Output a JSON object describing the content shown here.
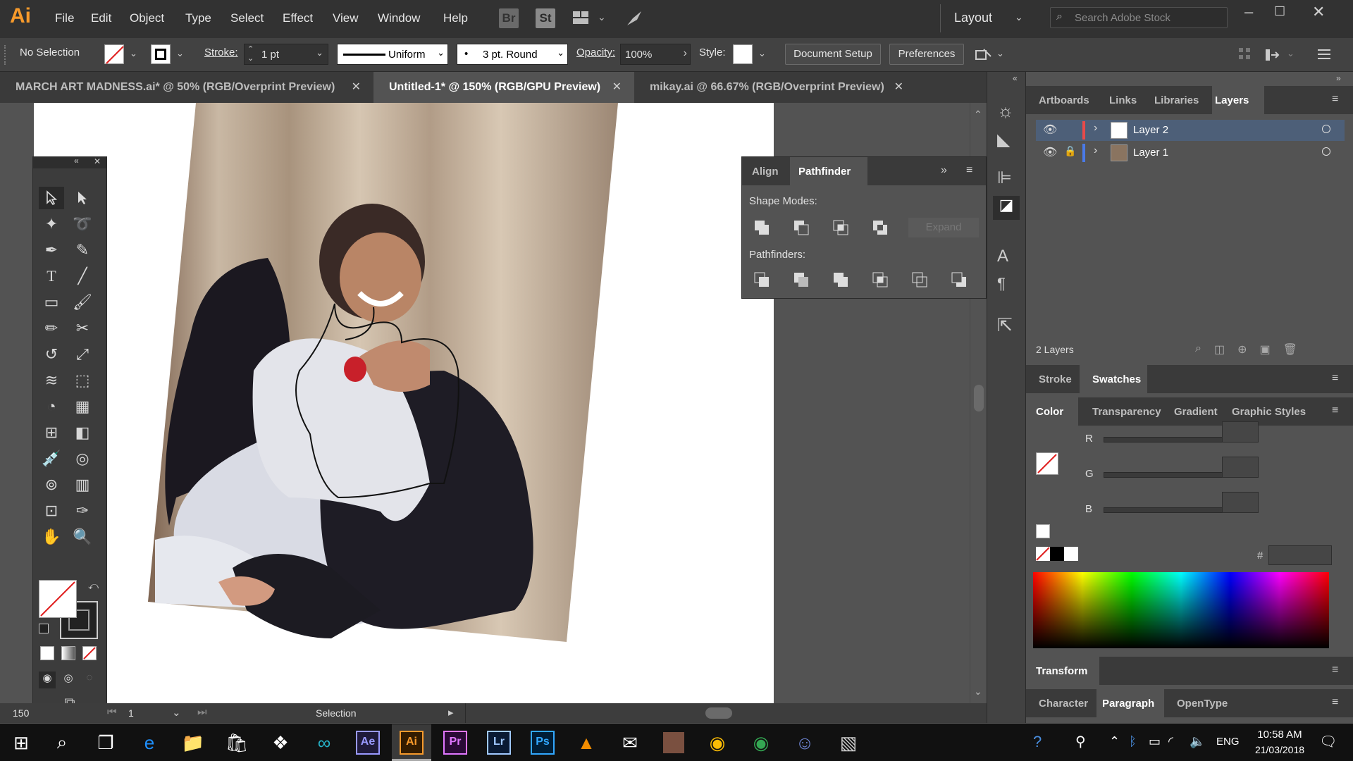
{
  "app": {
    "logo": "Ai"
  },
  "menu": [
    "File",
    "Edit",
    "Object",
    "Type",
    "Select",
    "Effect",
    "View",
    "Window",
    "Help"
  ],
  "bridge_btns": [
    "Br",
    "St"
  ],
  "workspace": {
    "label": "Layout"
  },
  "stock_search": {
    "placeholder": "Search Adobe Stock"
  },
  "control_bar": {
    "selection": "No Selection",
    "stroke_label": "Stroke:",
    "stroke_value": "1 pt",
    "profile": "Uniform",
    "brush": "3 pt. Round",
    "opacity_label": "Opacity:",
    "opacity_value": "100%",
    "style_label": "Style:",
    "document_setup": "Document Setup",
    "preferences": "Preferences"
  },
  "tabs": [
    {
      "label": "MARCH ART MADNESS.ai* @ 50% (RGB/Overprint Preview)",
      "active": false
    },
    {
      "label": "Untitled-1* @ 150% (RGB/GPU Preview)",
      "active": true
    },
    {
      "label": "mikay.ai @ 66.67% (RGB/Overprint Preview)",
      "active": false
    }
  ],
  "pathfinder_panel": {
    "tabs": [
      "Align",
      "Pathfinder"
    ],
    "shape_modes_label": "Shape Modes:",
    "expand": "Expand",
    "pathfinders_label": "Pathfinders:"
  },
  "layers_panel": {
    "tabs": [
      "Artboards",
      "Links",
      "Libraries",
      "Layers"
    ],
    "layers": [
      {
        "name": "Layer 2",
        "color": "#e84a4a",
        "selected": true
      },
      {
        "name": "Layer 1",
        "color": "#4a7ae8",
        "selected": false
      }
    ],
    "count": "2 Layers"
  },
  "stroke_panel": {
    "tabs": [
      "Stroke",
      "Swatches"
    ]
  },
  "color_panel": {
    "tabs": [
      "Color",
      "Transparency",
      "Gradient",
      "Graphic Styles"
    ],
    "channels": [
      "R",
      "G",
      "B"
    ],
    "hex_label": "#"
  },
  "transform_panel": {
    "title": "Transform"
  },
  "type_panel": {
    "tabs": [
      "Character",
      "Paragraph",
      "OpenType"
    ]
  },
  "status": {
    "zoom": "150",
    "artboard": "1",
    "tool": "Selection"
  },
  "taskbar": {
    "lang": "ENG",
    "time": "10:58 AM",
    "date": "21/03/2018",
    "apps": [
      "Ae",
      "Ai",
      "Pr",
      "Lr",
      "Ps"
    ]
  },
  "colors": {
    "ai_accent": "#f79a2b",
    "ae": "#9999ff",
    "pr": "#e077ff",
    "lr": "#a1c9ff",
    "ps": "#31a8ff"
  }
}
